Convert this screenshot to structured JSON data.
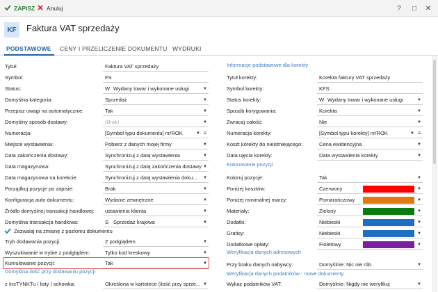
{
  "toolbar": {
    "save_label": "ZAPISZ",
    "cancel_label": "Anuluj",
    "help": "?",
    "maximize": "□",
    "close": "✕"
  },
  "header": {
    "logo": "KF",
    "title": "Faktura VAT sprzedaży"
  },
  "tabs": [
    {
      "label": "PODSTAWOWE",
      "active": true
    },
    {
      "label": "CENY I PRZELICZENIE DOKUMENTU",
      "active": false
    },
    {
      "label": "WYDRUKI",
      "active": false
    }
  ],
  "left": {
    "rows": [
      {
        "label": "Tytuł:",
        "value": "Faktura VAT sprzedaży",
        "type": "text"
      },
      {
        "label": "Symbol:",
        "value": "FS",
        "type": "text"
      },
      {
        "label": "Status:",
        "code": "W",
        "value": "Wydany towar i wykonane usługi",
        "type": "select"
      },
      {
        "label": "Domyślna kategoria:",
        "value": "Sprzedaż",
        "type": "select"
      },
      {
        "label": "Przepisz uwagi na automatycznie:",
        "value": "Tak",
        "type": "select"
      },
      {
        "label": "Domyślny sposób dostawy:",
        "value": "(Brak)",
        "type": "select",
        "placeholder": true
      },
      {
        "label": "Numeracja:",
        "value": "[Symbol typu dokumentu] nr/ROK",
        "type": "select-menu"
      },
      {
        "label": "Miejsce wystawienia:",
        "value": "Pobierz z danych mojej firmy",
        "type": "select"
      },
      {
        "label": "Data zakończenia dostawy:",
        "value": "Synchronizuj z datą wystawienia",
        "type": "select"
      },
      {
        "label": "Data magazynowa:",
        "value": "Synchronizuj z datą zakończenia dostawy",
        "type": "select"
      },
      {
        "label": "Data magazynowa na korekcie:",
        "value": "Synchronizuj z datą wystawienia doku...",
        "type": "select"
      },
      {
        "label": "Porządkuj pozycje po zapisie:",
        "value": "Brak",
        "type": "select"
      },
      {
        "label": "Konfiguracja auto dokumentu:",
        "value": "Wydanie zewnętrzne",
        "type": "select"
      },
      {
        "label": "Źródło domyślnej transakcji handlowej:",
        "value": "ustawienia klienta",
        "type": "select"
      },
      {
        "label": "Domyślna transakcja handlowa:",
        "code": "S",
        "value": "Sprzedaż krajowa",
        "type": "select"
      }
    ],
    "checkbox_label": "Zezwalaj na zmianę z poziomu dokumentu",
    "rows2": [
      {
        "label": "Tryb dodawania pozycji:",
        "value": "Z podglądem",
        "type": "select"
      },
      {
        "label": "Wyszukiwanie w trybie z podglądem:",
        "value": "Tylko kod kreskowy",
        "type": "select"
      },
      {
        "label": "Kumulowanie pozycji:",
        "value": "Tak",
        "type": "select",
        "highlight": true
      }
    ],
    "section_qty": "Domyślna ilość przy dodawaniu pozycji",
    "last_row": {
      "label": "z InsTYNKTu / listy / schowka:",
      "value": "Określona w kartotece (ilość przy sprze...",
      "type": "select"
    }
  },
  "right": {
    "section_correction": "Informacje podstawowe dla korekty",
    "rows": [
      {
        "label": "Tytuł korekty:",
        "value": "Korekta faktury VAT sprzedaży",
        "type": "text"
      },
      {
        "label": "Symbol korekty:",
        "value": "KFS",
        "type": "text"
      },
      {
        "label": "Status korekty:",
        "code": "W",
        "value": "Wydany towar i wykonane usługi",
        "type": "select"
      },
      {
        "label": "Sposób korygowania:",
        "value": "Korekta",
        "type": "select"
      },
      {
        "label": "Zwracaj całość:",
        "value": "Nie",
        "type": "select"
      },
      {
        "label": "Numeracja korekty:",
        "value": "[Symbol typu korekty] nr/ROK",
        "type": "select-menu"
      },
      {
        "label": "Koszt korekty do nieistniejącego:",
        "value": "Cena ewidencyjna",
        "type": "select"
      },
      {
        "label": "Data ujęcia korekty:",
        "value": "Data wystawienia korekty",
        "type": "select"
      }
    ],
    "section_coloring": "Kolorowanie pozycji",
    "color_rows": [
      {
        "label": "Koloruj pozycje:",
        "value": "Tak",
        "color": ""
      },
      {
        "label": "Poniżej kosztów:",
        "value": "Czerwony",
        "color": "#ff0000"
      },
      {
        "label": "Poniżej minimalnej marży:",
        "value": "Pomarańczowy",
        "color": "#e07a10"
      },
      {
        "label": "Materiały:",
        "value": "Zielony",
        "color": "#0b7a10"
      },
      {
        "label": "Dodatki:",
        "value": "Niebieski",
        "color": "#1f6fc0"
      },
      {
        "label": "Gratisy:",
        "value": "Niebieski",
        "color": "#1f6fc0"
      },
      {
        "label": "Dodatkowe opłaty:",
        "value": "Fioletowy",
        "color": "#7a1fa0"
      }
    ],
    "section_address": "Weryfikacja danych adresowych",
    "address_row": {
      "label": "Przy braku danych nabywcy:",
      "value": "Domyślnie: Nic nie rób"
    },
    "section_taxpayers": "Weryfikacja danych podatników - nowe dokumenty",
    "taxpayers_row": {
      "label": "Wykaz podatników VAT:",
      "value": "Domyślnie: Nigdy nie weryfikuj"
    }
  },
  "colors": {
    "accent": "#1f5f9f",
    "section": "#3f7fbf",
    "save_green": "#2f7d32",
    "highlight": "#d9534f"
  }
}
